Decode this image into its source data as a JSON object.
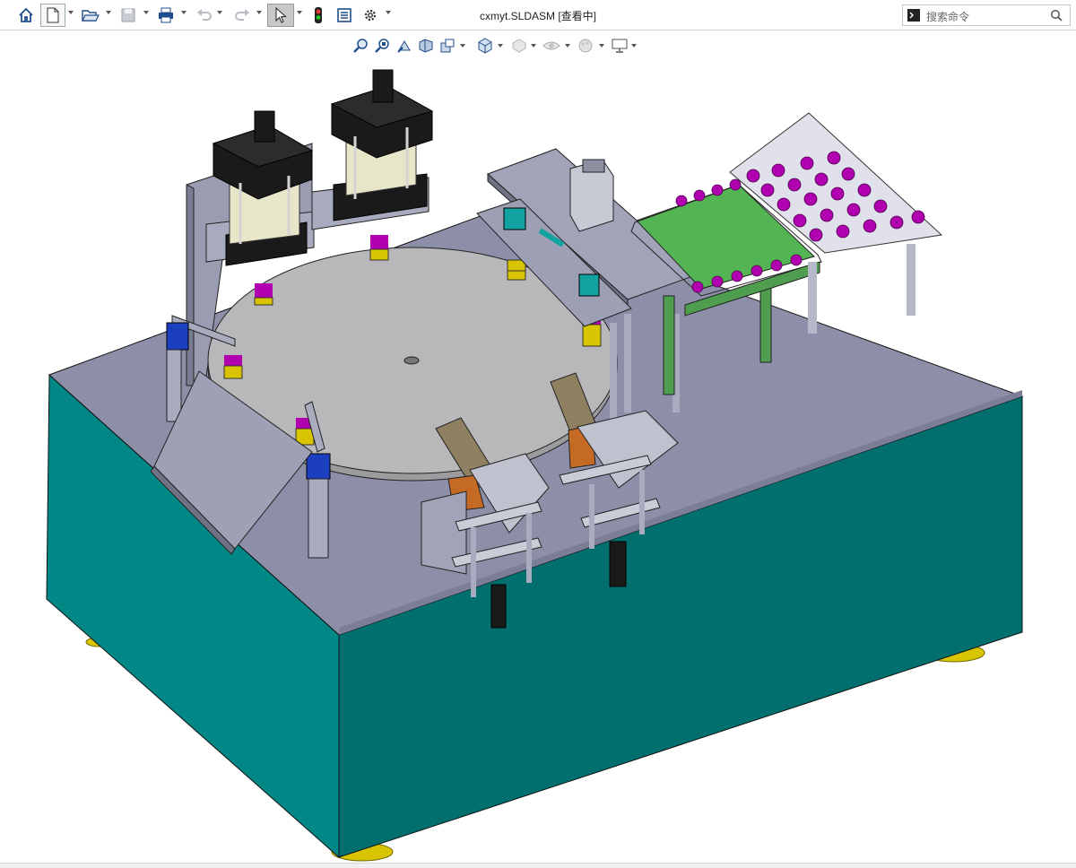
{
  "app": {
    "title": "cxmyt.SLDASM [查看中]"
  },
  "search": {
    "placeholder": "搜索命令"
  },
  "toolbar": {
    "buttons": [
      {
        "name": "home-button",
        "icon": "home-icon"
      },
      {
        "name": "new-document-button",
        "icon": "new-document-icon"
      },
      {
        "name": "open-button",
        "icon": "folder-open-icon"
      },
      {
        "name": "save-button",
        "icon": "save-icon"
      },
      {
        "name": "print-button",
        "icon": "printer-icon"
      },
      {
        "name": "undo-button",
        "icon": "undo-icon"
      },
      {
        "name": "redo-button",
        "icon": "redo-icon"
      },
      {
        "name": "select-button",
        "icon": "cursor-icon"
      },
      {
        "name": "rebuild-button",
        "icon": "traffic-light-icon"
      },
      {
        "name": "file-properties-button",
        "icon": "file-properties-icon"
      },
      {
        "name": "options-button",
        "icon": "gear-icon"
      }
    ]
  },
  "view_toolbar": {
    "buttons": [
      {
        "name": "zoom-to-fit-button",
        "icon": "zoom-fit-icon"
      },
      {
        "name": "zoom-to-area-button",
        "icon": "zoom-area-icon"
      },
      {
        "name": "previous-view-button",
        "icon": "previous-view-icon"
      },
      {
        "name": "section-view-button",
        "icon": "section-view-icon"
      },
      {
        "name": "dynamic-annotation-button",
        "icon": "annotation-view-icon"
      },
      {
        "name": "view-orientation-button",
        "icon": "cube-icon"
      },
      {
        "name": "display-style-button",
        "icon": "display-style-icon"
      },
      {
        "name": "hide-show-items-button",
        "icon": "eye-icon"
      },
      {
        "name": "edit-appearance-button",
        "icon": "appearance-icon"
      },
      {
        "name": "apply-scene-button",
        "icon": "scene-icon"
      },
      {
        "name": "view-settings-button",
        "icon": "monitor-icon"
      }
    ]
  },
  "model": {
    "colors": {
      "base": "#00807f",
      "base_side": "#006e6d",
      "top_plate": "#8b8ea6",
      "turntable": "#b7b7b9",
      "conveyor": "#4f9e4f",
      "parts": "#b000b0",
      "cylinder_body": "#e7e6c8",
      "cylinder_cap": "#1a1a1a",
      "feet": "#d8c400"
    }
  }
}
